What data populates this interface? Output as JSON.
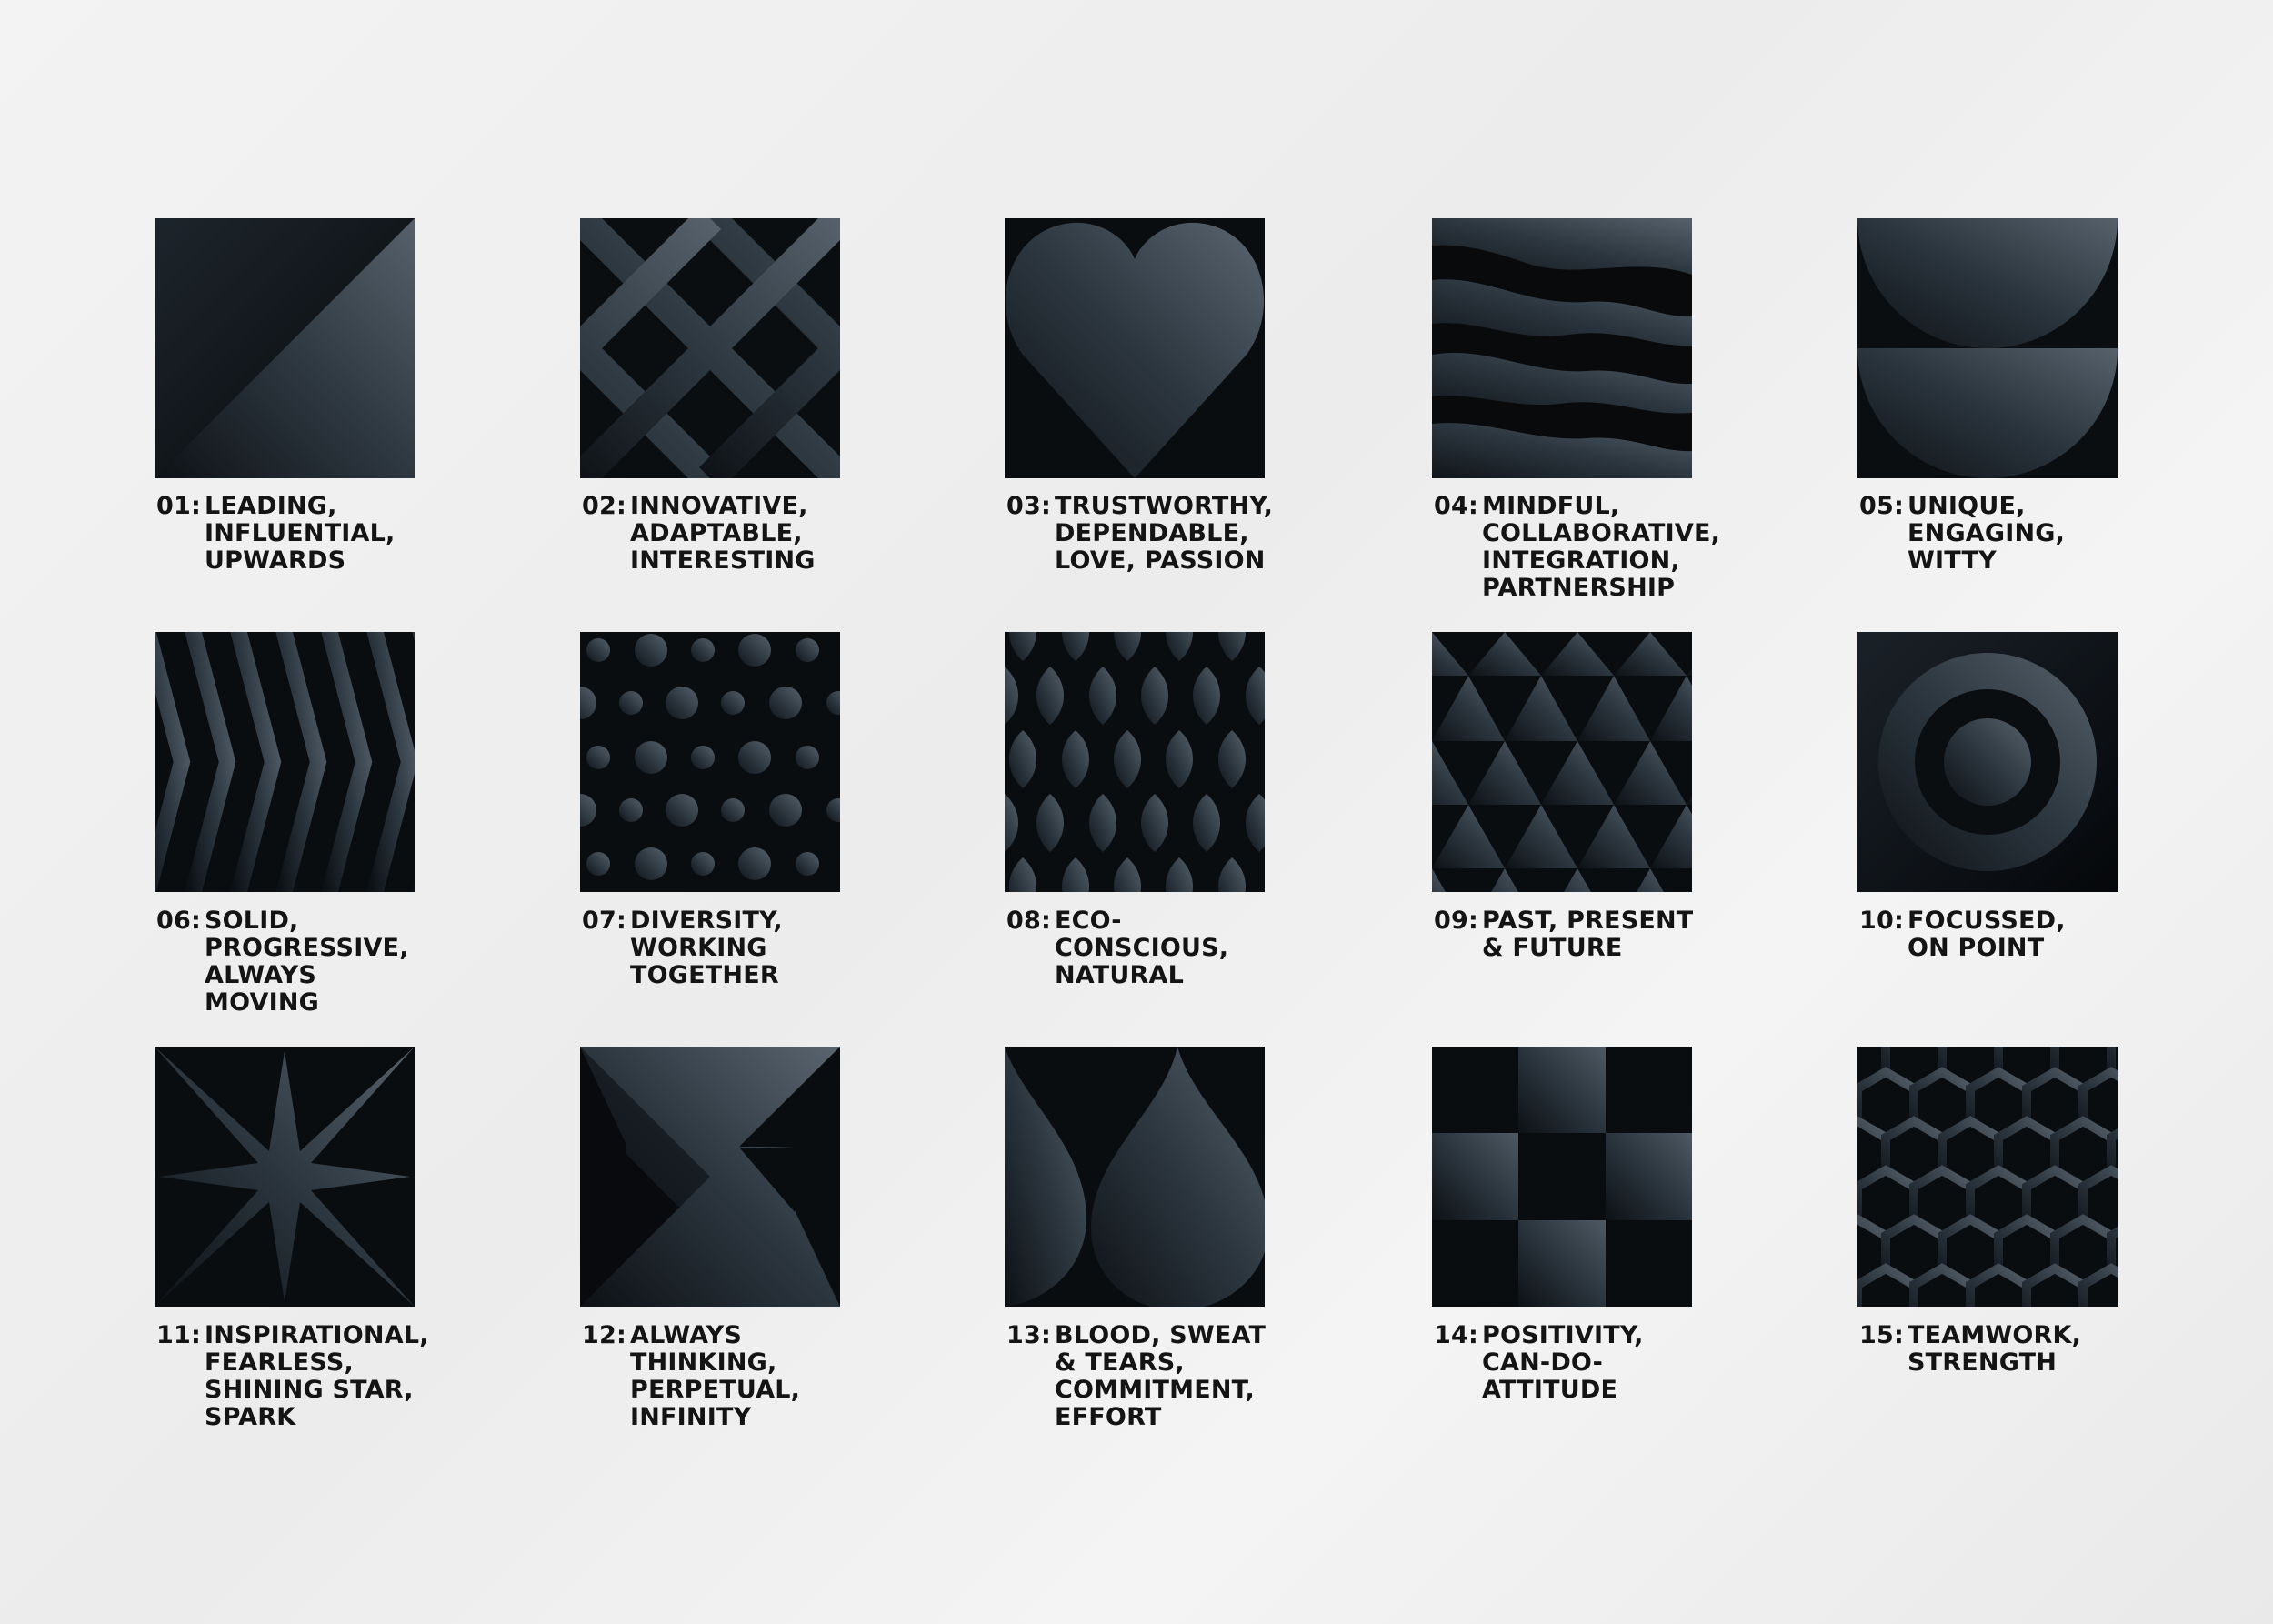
{
  "colors": {
    "background": "#efefef",
    "tile_dark": "#0a0d10",
    "tile_light": "#3a444d",
    "label": "#141414"
  },
  "tiles": [
    {
      "number": "01:",
      "text": "LEADING,\nINFLUENTIAL,\nUPWARDS",
      "icon": "diagonal-split-pattern"
    },
    {
      "number": "02:",
      "text": "INNOVATIVE,\nADAPTABLE,\nINTERESTING",
      "icon": "diamond-lattice-pattern"
    },
    {
      "number": "03:",
      "text": "TRUSTWORTHY,\nDEPENDABLE,\nLOVE, PASSION",
      "icon": "heart-pattern"
    },
    {
      "number": "04:",
      "text": "MINDFUL,\nCOLLABORATIVE,\nINTEGRATION,\nPARTNERSHIP",
      "icon": "wave-bands-pattern"
    },
    {
      "number": "05:",
      "text": "UNIQUE,\nENGAGING,\nWITTY",
      "icon": "half-circles-pattern"
    },
    {
      "number": "06:",
      "text": "SOLID,\nPROGRESSIVE,\nALWAYS\nMOVING",
      "icon": "chevron-stripes-pattern"
    },
    {
      "number": "07:",
      "text": "DIVERSITY,\nWORKING\nTOGETHER",
      "icon": "dots-pattern"
    },
    {
      "number": "08:",
      "text": "ECO-\nCONSCIOUS,\nNATURAL",
      "icon": "leaves-pattern"
    },
    {
      "number": "09:",
      "text": "PAST, PRESENT\n& FUTURE",
      "icon": "triangles-pattern"
    },
    {
      "number": "10:",
      "text": "FOCUSSED,\nON POINT",
      "icon": "target-pattern"
    },
    {
      "number": "11:",
      "text": "INSPIRATIONAL,\nFEARLESS,\nSHINING STAR,\nSPARK",
      "icon": "star-pattern"
    },
    {
      "number": "12:",
      "text": "ALWAYS\nTHINKING,\nPERPETUAL,\nINFINITY",
      "icon": "infinity-pattern"
    },
    {
      "number": "13:",
      "text": "BLOOD, SWEAT\n& TEARS,\nCOMMITMENT,\nEFFORT",
      "icon": "drops-pattern"
    },
    {
      "number": "14:",
      "text": "POSITIVITY,\nCAN-DO-\nATTITUDE",
      "icon": "checkerboard-pattern"
    },
    {
      "number": "15:",
      "text": "TEAMWORK,\nSTRENGTH",
      "icon": "hexagon-pattern"
    }
  ]
}
